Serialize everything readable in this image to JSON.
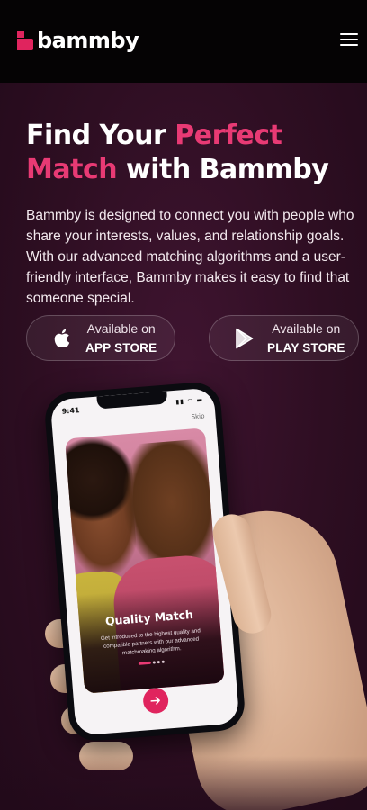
{
  "header": {
    "brand_name": "bammby",
    "menu_icon": "hamburger-menu-icon",
    "brand_color": "#e0245e"
  },
  "hero": {
    "headline_part1": "Find Your ",
    "headline_highlight1": "Perfect",
    "headline_highlight2": "Match",
    "headline_part2": " with Bammby",
    "description": "Bammby is designed to connect you with people who share your interests, values, and relationship goals. With our advanced matching algorithms and a user-friendly interface, Bammby makes it easy to find that someone special.",
    "accent_color": "#e83a74"
  },
  "stores": {
    "apple": {
      "small": "Available on",
      "big": "APP STORE",
      "icon": "apple-icon"
    },
    "google": {
      "small": "Available on",
      "big": "PLAY STORE",
      "icon": "play-store-icon"
    }
  },
  "phone": {
    "time": "9:41",
    "skip": "Skip",
    "card_title": "Quality Match",
    "card_body": "Get introduced to the highest quality and compatible partners with our advanced matchmaking algorithm.",
    "next_icon": "arrow-right-icon"
  }
}
